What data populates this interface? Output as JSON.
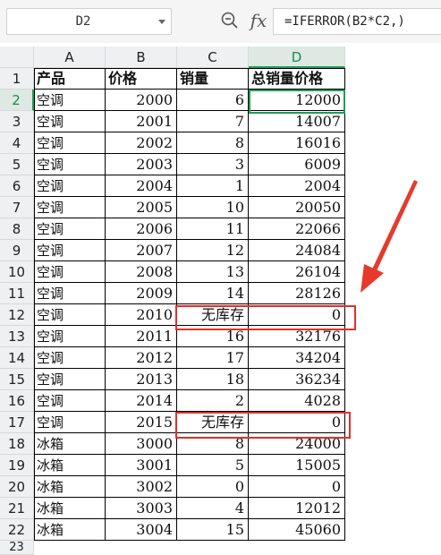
{
  "name_box": {
    "value": "D2"
  },
  "formula_bar": {
    "formula": "=IFERROR(B2*C2,)",
    "fx_label": "fx"
  },
  "columns": [
    "A",
    "B",
    "C",
    "D"
  ],
  "active_cell": "D2",
  "header_row": {
    "row": "1",
    "cells": [
      "产品",
      "价格",
      "销量",
      "总销量价格"
    ]
  },
  "rows": [
    {
      "n": "2",
      "a": "空调",
      "b": "2000",
      "c": "6",
      "d": "12000"
    },
    {
      "n": "3",
      "a": "空调",
      "b": "2001",
      "c": "7",
      "d": "14007"
    },
    {
      "n": "4",
      "a": "空调",
      "b": "2002",
      "c": "8",
      "d": "16016"
    },
    {
      "n": "5",
      "a": "空调",
      "b": "2003",
      "c": "3",
      "d": "6009"
    },
    {
      "n": "6",
      "a": "空调",
      "b": "2004",
      "c": "1",
      "d": "2004"
    },
    {
      "n": "7",
      "a": "空调",
      "b": "2005",
      "c": "10",
      "d": "20050"
    },
    {
      "n": "8",
      "a": "空调",
      "b": "2006",
      "c": "11",
      "d": "22066"
    },
    {
      "n": "9",
      "a": "空调",
      "b": "2007",
      "c": "12",
      "d": "24084"
    },
    {
      "n": "10",
      "a": "空调",
      "b": "2008",
      "c": "13",
      "d": "26104"
    },
    {
      "n": "11",
      "a": "空调",
      "b": "2009",
      "c": "14",
      "d": "28126"
    },
    {
      "n": "12",
      "a": "空调",
      "b": "2010",
      "c": "无库存",
      "d": "0"
    },
    {
      "n": "13",
      "a": "空调",
      "b": "2011",
      "c": "16",
      "d": "32176"
    },
    {
      "n": "14",
      "a": "空调",
      "b": "2012",
      "c": "17",
      "d": "34204"
    },
    {
      "n": "15",
      "a": "空调",
      "b": "2013",
      "c": "18",
      "d": "36234"
    },
    {
      "n": "16",
      "a": "空调",
      "b": "2014",
      "c": "2",
      "d": "4028"
    },
    {
      "n": "17",
      "a": "空调",
      "b": "2015",
      "c": "无库存",
      "d": "0"
    },
    {
      "n": "18",
      "a": "冰箱",
      "b": "3000",
      "c": "8",
      "d": "24000"
    },
    {
      "n": "19",
      "a": "冰箱",
      "b": "3001",
      "c": "5",
      "d": "15005"
    },
    {
      "n": "20",
      "a": "冰箱",
      "b": "3002",
      "c": "0",
      "d": "0"
    },
    {
      "n": "21",
      "a": "冰箱",
      "b": "3003",
      "c": "4",
      "d": "12012"
    },
    {
      "n": "22",
      "a": "冰箱",
      "b": "3004",
      "c": "15",
      "d": "45060"
    }
  ],
  "partial_row": "23",
  "colors": {
    "accent_green": "#1e9d5a",
    "highlight_red": "#e0302a"
  }
}
